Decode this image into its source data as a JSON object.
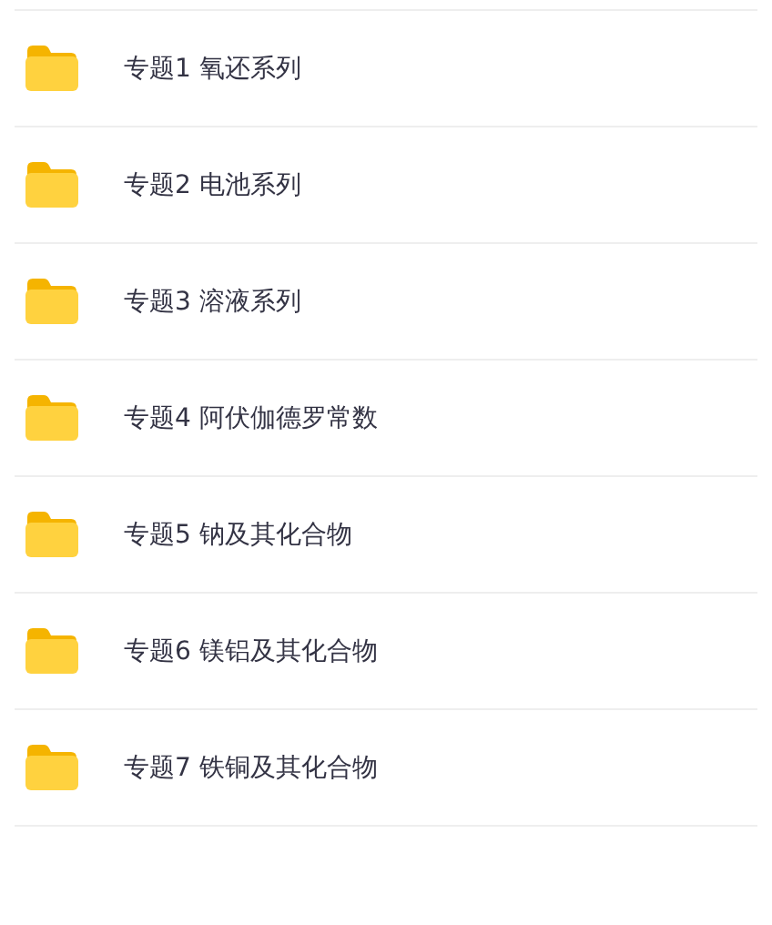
{
  "folders": [
    {
      "name": "专题1 氧还系列"
    },
    {
      "name": "专题2 电池系列"
    },
    {
      "name": "专题3 溶液系列"
    },
    {
      "name": "专题4 阿伏伽德罗常数"
    },
    {
      "name": "专题5 钠及其化合物"
    },
    {
      "name": "专题6 镁铝及其化合物"
    },
    {
      "name": "专题7 铁铜及其化合物"
    }
  ]
}
